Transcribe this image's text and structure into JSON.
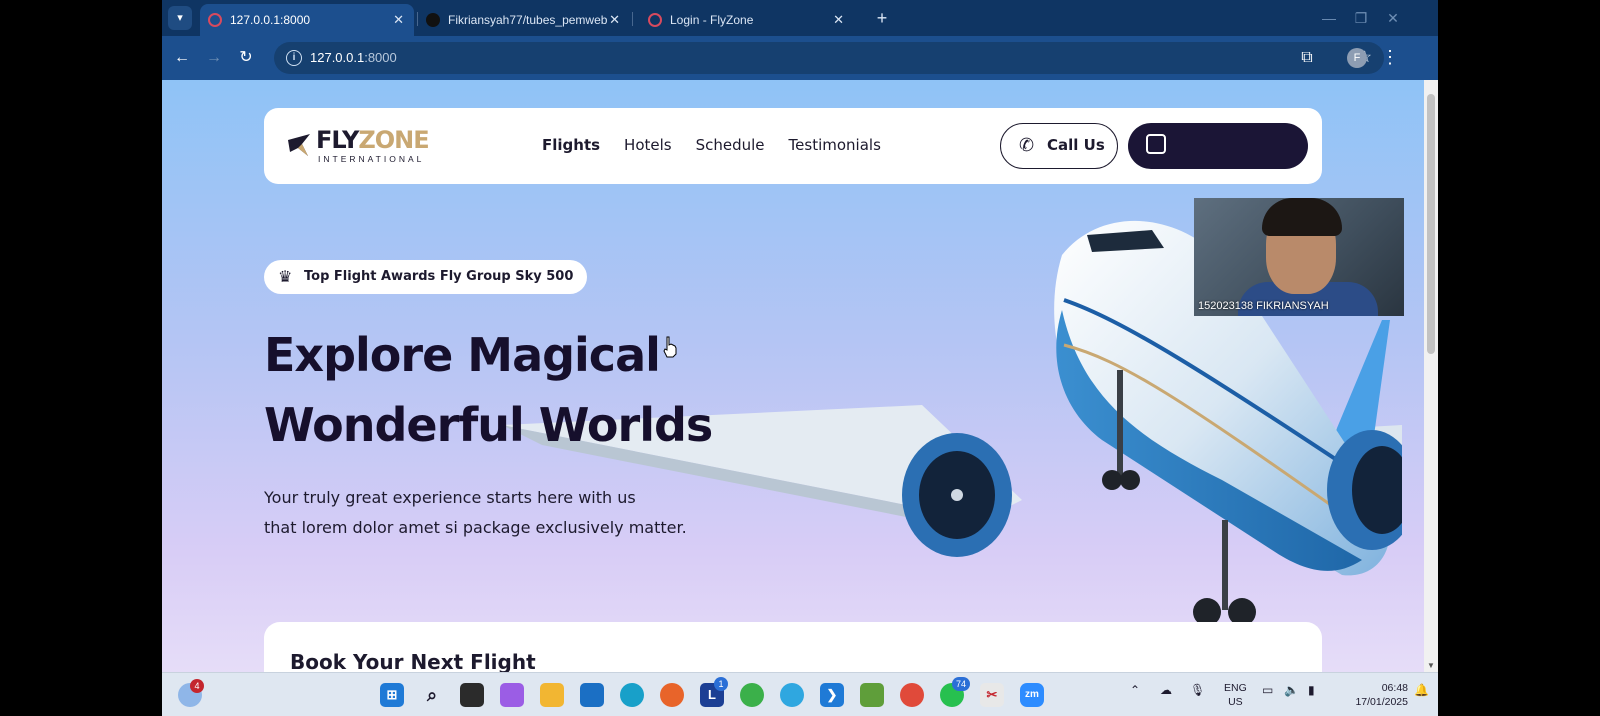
{
  "browser": {
    "tabs": [
      {
        "title": "127.0.0.1:8000",
        "close": "✕"
      },
      {
        "title": "Fikriansyah77/tubes_pemweb",
        "close": "✕"
      },
      {
        "title": "Login - FlyZone",
        "close": "✕"
      }
    ],
    "new_tab": "+",
    "url_host": "127.0.0.1",
    "url_port": ":8000"
  },
  "site": {
    "logo_fly": "FLY",
    "logo_zone": "ZONE",
    "logo_sub": "INTERNATIONAL",
    "nav": [
      "Flights",
      "Hotels",
      "Schedule",
      "Testimonials"
    ],
    "call_label": "Call Us",
    "badge": "Top Flight Awards Fly Group Sky 500",
    "hero_line1": "Explore Magical",
    "hero_line2": "Wonderful Worlds",
    "hero_sub1": "Your truly great experience starts here with us",
    "hero_sub2": "that lorem dolor amet si package exclusively matter.",
    "booking_title": "Book Your Next Flight"
  },
  "webcam": {
    "label": "152023138 FIKRIANSYAH"
  },
  "taskbar": {
    "weather_badge": "4",
    "l_badge": "1",
    "whatsapp_badge": "74",
    "lang_top": "ENG",
    "lang_bottom": "US",
    "time": "06:48",
    "date": "17/01/2025"
  },
  "colors": {
    "brand_dark": "#1b1536",
    "brand_gold": "#c9a872",
    "chrome_blue": "#1c4f8e"
  }
}
